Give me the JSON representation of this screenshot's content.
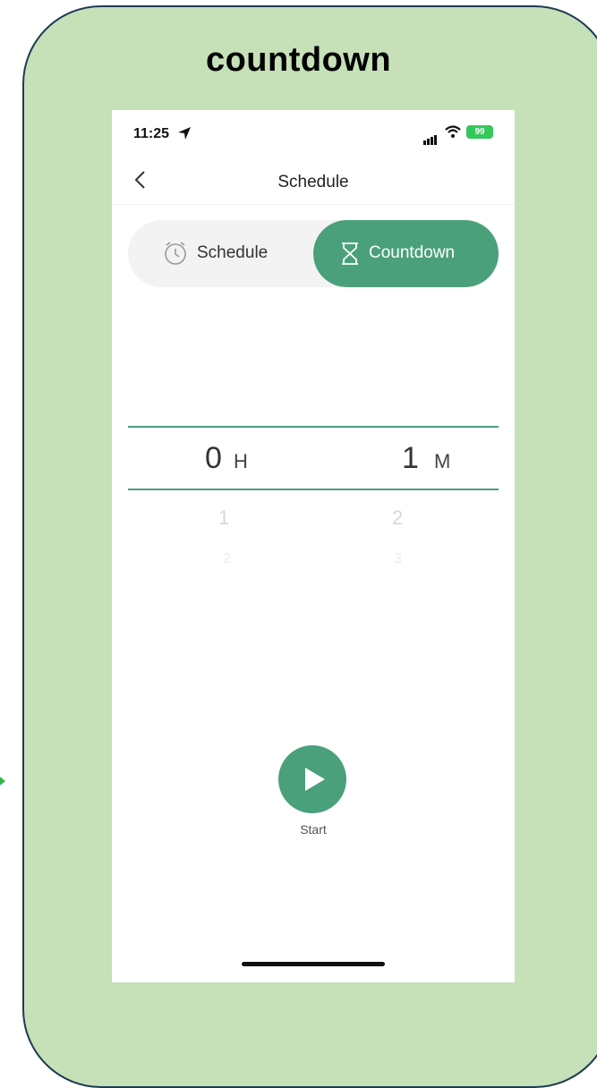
{
  "frame": {
    "title": "countdown"
  },
  "status": {
    "time": "11:25",
    "battery": "99"
  },
  "nav": {
    "title": "Schedule"
  },
  "tabs": {
    "schedule": "Schedule",
    "countdown": "Countdown"
  },
  "picker": {
    "hours": {
      "value": "0",
      "unit": "H",
      "next": "1",
      "next2": "2"
    },
    "minutes": {
      "value": "1",
      "unit": "M",
      "next": "2",
      "next2": "3"
    }
  },
  "start": {
    "label": "Start"
  },
  "colors": {
    "accent": "#4aa07b",
    "frame_bg": "#c6e0b8",
    "frame_border": "#1f3b55",
    "arrow": "#2db34a"
  },
  "icons": {
    "back": "chevron-left-icon",
    "schedule": "alarm-clock-icon",
    "countdown": "hourglass-icon",
    "start": "play-icon"
  }
}
